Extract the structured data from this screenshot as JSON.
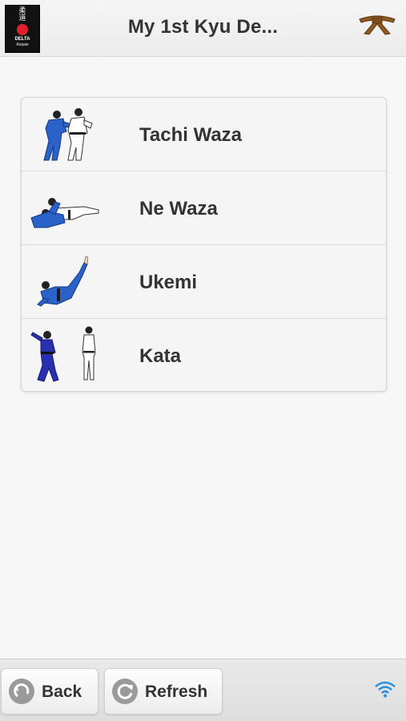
{
  "header": {
    "title": "My 1st Kyu De...",
    "logo": {
      "kanji": "柔道",
      "line1": "DELTA",
      "line2": "Keiyan"
    },
    "belt_icon": "brown-belt-icon",
    "belt_color": "#8a5a22"
  },
  "menu": {
    "items": [
      {
        "label": "Tachi Waza",
        "icon": "standing-throw-illustration"
      },
      {
        "label": "Ne Waza",
        "icon": "ground-grappling-illustration"
      },
      {
        "label": "Ukemi",
        "icon": "breakfall-illustration"
      },
      {
        "label": "Kata",
        "icon": "kata-pair-illustration"
      }
    ]
  },
  "footer": {
    "back_label": "Back",
    "refresh_label": "Refresh",
    "connectivity_icon": "wifi-icon",
    "wifi_color": "#2a8fdc"
  },
  "colors": {
    "judogi_blue": "#2a62c9",
    "judogi_white": "#ffffff",
    "text": "#333333"
  }
}
